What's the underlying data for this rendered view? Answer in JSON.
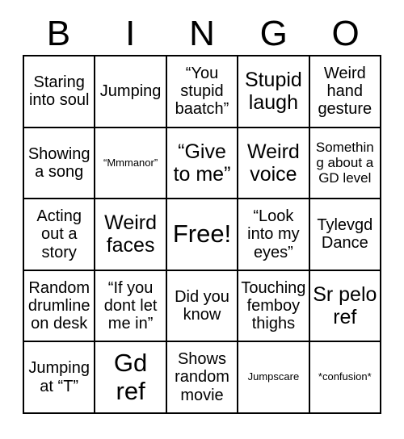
{
  "header": {
    "letters": [
      "B",
      "I",
      "N",
      "G",
      "O"
    ]
  },
  "grid": {
    "columns": 5,
    "rows": 5,
    "cells": [
      {
        "text": "Staring into soul",
        "size": "md"
      },
      {
        "text": "Jumping",
        "size": "md"
      },
      {
        "text": "“You stupid baatch”",
        "size": "md"
      },
      {
        "text": "Stupid laugh",
        "size": "lg"
      },
      {
        "text": "Weird hand gesture",
        "size": "md"
      },
      {
        "text": "Showing a song",
        "size": "md"
      },
      {
        "text": "“Mmmanor”",
        "size": "xs"
      },
      {
        "text": "“Give to me”",
        "size": "lg"
      },
      {
        "text": "Weird voice",
        "size": "lg"
      },
      {
        "text": "Something about a GD level",
        "size": "sm"
      },
      {
        "text": "Acting out a story",
        "size": "md"
      },
      {
        "text": "Weird faces",
        "size": "lg"
      },
      {
        "text": "Free!",
        "size": "xl"
      },
      {
        "text": "“Look into my eyes”",
        "size": "md"
      },
      {
        "text": "Tylevgd Dance",
        "size": "md"
      },
      {
        "text": "Random drumline on desk",
        "size": "md"
      },
      {
        "text": "“If you dont let me in”",
        "size": "md"
      },
      {
        "text": "Did you know",
        "size": "md"
      },
      {
        "text": "Touching femboy thighs",
        "size": "md"
      },
      {
        "text": "Sr pelo ref",
        "size": "lg"
      },
      {
        "text": "Jumping at “T”",
        "size": "md"
      },
      {
        "text": "Gd ref",
        "size": "xl"
      },
      {
        "text": "Shows random movie",
        "size": "md"
      },
      {
        "text": "Jumpscare",
        "size": "xs"
      },
      {
        "text": "*confusion*",
        "size": "xs"
      }
    ]
  }
}
